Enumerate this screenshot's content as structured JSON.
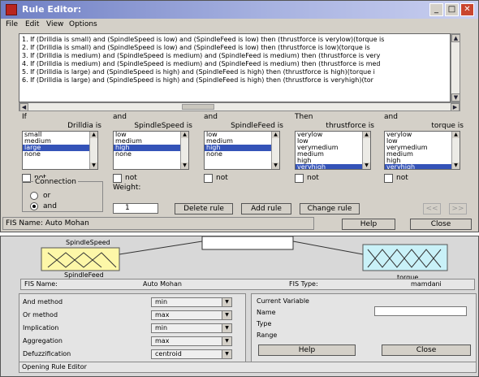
{
  "rule_editor": {
    "title": "Rule Editor:",
    "menu": [
      "File",
      "Edit",
      "View",
      "Options"
    ],
    "rules": [
      "1. If (Drilldia is small) and (SpindleSpeed is low) and (SpindleFeed is low) then (thrustforce is verylow)(torque is",
      "2. If (Drilldia is small) and (SpindleSpeed is low) and (SpindleFeed is low) then (thrustforce is low)(torque is",
      "3. If (Drilldia is medium) and (SpindleSpeed is medium) and (SpindleFeed is medium) then (thrustforce is very",
      "4. If (Drilldia is medium) and (SpindleSpeed is medium) and (SpindleFeed is medium) then (thrustforce is med",
      "5. If (Drilldia is large) and (SpindleSpeed is high) and (SpindleFeed is high) then (thrustforce is high)(torque i",
      "6. If (Drilldia is large) and (SpindleSpeed is high) and (SpindleFeed is high) then (thrustforce is veryhigh)(tor"
    ],
    "columns": [
      {
        "top": "If",
        "label": "Drilldia is",
        "items": [
          "small",
          "medium",
          "large",
          "none"
        ],
        "selected": 2
      },
      {
        "top": "and",
        "label": "SpindleSpeed is",
        "items": [
          "low",
          "medium",
          "high",
          "none"
        ],
        "selected": 2
      },
      {
        "top": "and",
        "label": "SpindleFeed is",
        "items": [
          "low",
          "medium",
          "high",
          "none"
        ],
        "selected": 2
      },
      {
        "top": "Then",
        "label": "thrustforce is",
        "items": [
          "verylow",
          "low",
          "verymedium",
          "medium",
          "high",
          "veryhigh"
        ],
        "selected": 5
      },
      {
        "top": "and",
        "label": "torque is",
        "items": [
          "verylow",
          "low",
          "verymedium",
          "medium",
          "high",
          "veryhigh"
        ],
        "selected": 5
      }
    ],
    "not_label": "not",
    "connection_label": "Connection",
    "or_label": "or",
    "and_label": "and",
    "weight_label": "Weight:",
    "weight_value": "1",
    "delete_rule": "Delete rule",
    "add_rule": "Add rule",
    "change_rule": "Change rule",
    "prev_button": "<<",
    "next_button": ">>",
    "status": "FIS Name: Auto Mohan",
    "help": "Help",
    "close": "Close"
  },
  "fis_editor": {
    "input_label_top": "SpindleSpeed",
    "input_label_bottom": "SpindleFeed",
    "output_label": "torque",
    "fis_name_label": "FIS Name:",
    "fis_name_value": "Auto Mohan",
    "fis_type_label": "FIS Type:",
    "fis_type_value": "mamdani",
    "methods": [
      {
        "label": "And method",
        "value": "min"
      },
      {
        "label": "Or method",
        "value": "max"
      },
      {
        "label": "Implication",
        "value": "min"
      },
      {
        "label": "Aggregation",
        "value": "max"
      },
      {
        "label": "Defuzzification",
        "value": "centroid"
      }
    ],
    "current_variable": "Current Variable",
    "name_label": "Name",
    "type_label": "Type",
    "range_label": "Range",
    "help": "Help",
    "close": "Close",
    "status": "Opening Rule Editor"
  },
  "colors": {
    "title_gradient_start": "#6f7fc4",
    "selection": "#3453b8",
    "input_block": "#fdf7a8",
    "output_block": "#c9f1f8"
  }
}
